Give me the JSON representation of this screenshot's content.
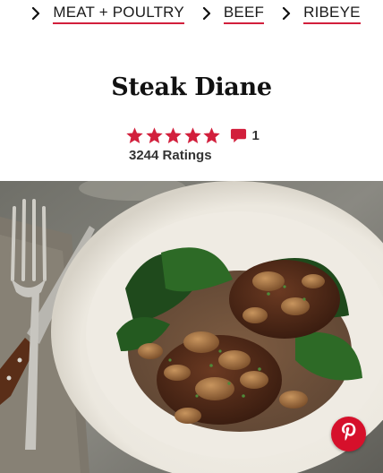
{
  "breadcrumb": {
    "items": [
      {
        "label": "MEAT + POULTRY"
      },
      {
        "label": "BEEF"
      },
      {
        "label": "RIBEYE"
      }
    ]
  },
  "recipe": {
    "title": "Steak Diane",
    "rating": {
      "stars": 5,
      "max_stars": 5,
      "review_count": "1",
      "ratings_label": "3244 Ratings"
    },
    "photo_alt": "steak-diane-photo"
  },
  "colors": {
    "accent_red": "#d21f3c",
    "pinterest_red": "#d6102b"
  },
  "icons": {
    "separator": "chevron-right-icon",
    "review": "comment-icon",
    "share": "pinterest-icon"
  }
}
